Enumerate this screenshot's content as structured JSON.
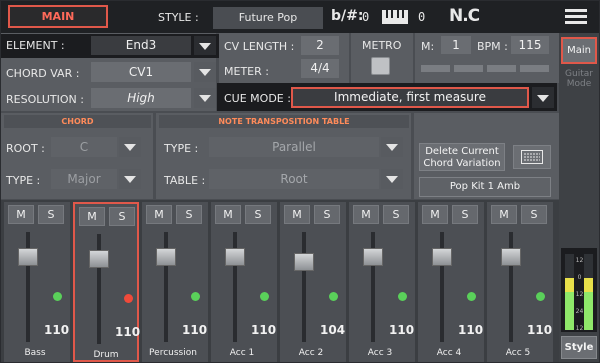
{
  "topbar": {
    "tab_main": "MAIN",
    "style_label": "STYLE :",
    "style_value": "Future Pop",
    "transpose_label": "b/#:",
    "transpose_value": "0",
    "keyboard_value": "0",
    "chord": "N.C"
  },
  "left": {
    "element_label": "ELEMENT :",
    "element_value": "End3",
    "chordvar_label": "CHORD VAR :",
    "chordvar_value": "CV1",
    "resolution_label": "RESOLUTION :",
    "resolution_value": "High"
  },
  "center": {
    "cvlength_label": "CV LENGTH :",
    "cvlength_value": "2",
    "meter_label": "METER :",
    "meter_value": "4/4",
    "metro_label": "METRO",
    "measure_label": "M:",
    "measure_value": "1",
    "bpm_label": "BPM :",
    "bpm_value": "115",
    "cuemode_label": "CUE MODE :",
    "cuemode_value": "Immediate, first measure"
  },
  "chord": {
    "title": "CHORD",
    "root_label": "ROOT :",
    "root_value": "C",
    "type_label": "TYPE :",
    "type_value": "Major"
  },
  "nt_table": {
    "title": "NOTE TRANSPOSITION TABLE",
    "type_label": "TYPE :",
    "type_value": "Parallel",
    "table_label": "TABLE :",
    "table_value": "Root"
  },
  "right": {
    "delete_label_line1": "Delete Current",
    "delete_label_line2": "Chord Variation",
    "kit_label": "Pop Kit 1 Amb"
  },
  "side_tabs": {
    "main": "Main",
    "guitar_line1": "Guitar",
    "guitar_line2": "Mode",
    "style": "Style"
  },
  "mute_label": "M",
  "solo_label": "S",
  "channels": [
    {
      "name": "Bass",
      "volume": "110",
      "dot": "green"
    },
    {
      "name": "Drum",
      "volume": "110",
      "dot": "red"
    },
    {
      "name": "Percussion",
      "volume": "110",
      "dot": "green"
    },
    {
      "name": "Acc 1",
      "volume": "110",
      "dot": "green"
    },
    {
      "name": "Acc 2",
      "volume": "104",
      "dot": "green"
    },
    {
      "name": "Acc 3",
      "volume": "110",
      "dot": "green"
    },
    {
      "name": "Acc 4",
      "volume": "110",
      "dot": "green"
    },
    {
      "name": "Acc 5",
      "volume": "110",
      "dot": "green"
    }
  ],
  "meter_scale": [
    "12",
    "0",
    "12",
    "24",
    "12"
  ],
  "colors": {
    "accent": "#e0584a",
    "green": "#5ad05a",
    "red": "#f04a3a",
    "meter_yellow": "#e8e04a",
    "meter_green": "#8fe86a"
  }
}
